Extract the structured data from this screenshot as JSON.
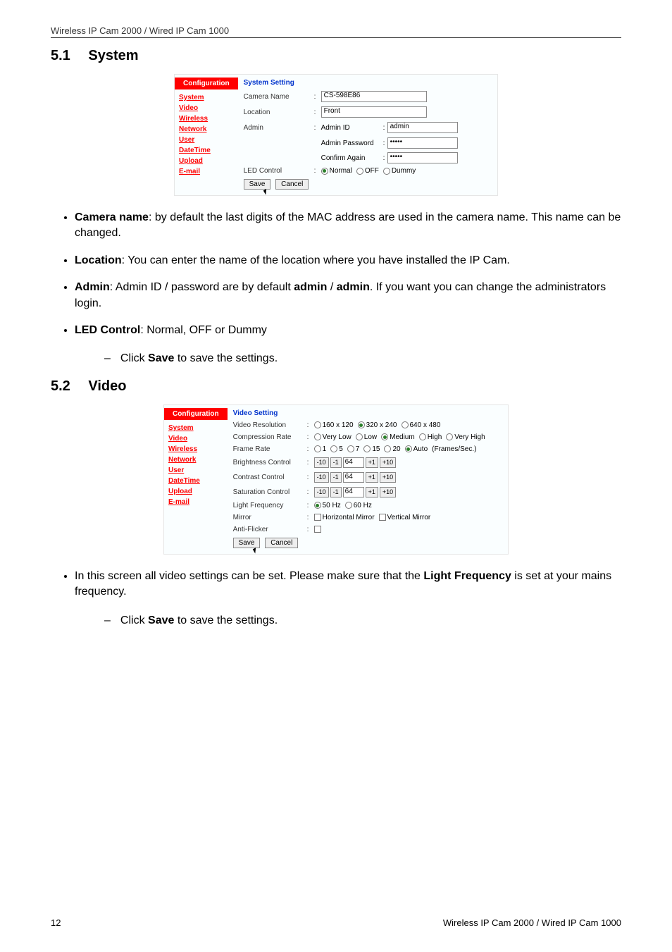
{
  "header": "Wireless IP Cam 2000 / Wired IP Cam 1000",
  "section51": {
    "num": "5.1",
    "title": "System"
  },
  "section52": {
    "num": "5.2",
    "title": "Video"
  },
  "sidebar": {
    "title": "Configuration",
    "items": [
      "System",
      "Video",
      "Wireless",
      "Network",
      "User",
      "DateTime",
      "Upload",
      "E-mail"
    ]
  },
  "systemPane": {
    "title": "System Setting",
    "cameraNameLabel": "Camera Name",
    "cameraNameValue": "CS-598E86",
    "locationLabel": "Location",
    "locationValue": "Front",
    "adminLabel": "Admin",
    "adminIdLabel": "Admin ID",
    "adminIdValue": "admin",
    "adminPwLabel": "Admin Password",
    "adminPwValue": "•••••",
    "confirmLabel": "Confirm Again",
    "confirmValue": "•••••",
    "ledLabel": "LED Control",
    "ledOpts": [
      "Normal",
      "OFF",
      "Dummy"
    ],
    "save": "Save",
    "cancel": "Cancel"
  },
  "videoPane": {
    "title": "Video Setting",
    "resLabel": "Video Resolution",
    "resOpts": [
      "160 x 120",
      "320 x 240",
      "640 x 480"
    ],
    "compLabel": "Compression Rate",
    "compOpts": [
      "Very Low",
      "Low",
      "Medium",
      "High",
      "Very High"
    ],
    "frameLabel": "Frame Rate",
    "frameOpts": [
      "1",
      "5",
      "7",
      "15",
      "20",
      "Auto"
    ],
    "frameSuffix": "(Frames/Sec.)",
    "brightnessLabel": "Brightness Control",
    "contrastLabel": "Contrast Control",
    "saturationLabel": "Saturation Control",
    "stepMinus10": "-10",
    "stepMinus1": "-1",
    "stepVal": "64",
    "stepPlus1": "+1",
    "stepPlus10": "+10",
    "lightFreqLabel": "Light Frequency",
    "lightFreqOpts": [
      "50 Hz",
      "60 Hz"
    ],
    "mirrorLabel": "Mirror",
    "mirrorOpts": [
      "Horizontal Mirror",
      "Vertical Mirror"
    ],
    "antiFlickerLabel": "Anti-Flicker",
    "save": "Save",
    "cancel": "Cancel"
  },
  "body": {
    "b1a": "Camera name",
    "b1b": ": by default the last digits of the MAC address are used in the camera name. This name can be changed.",
    "b2a": "Location",
    "b2b": ": You can enter the name of the location where you have installed the IP Cam.",
    "b3a": "Admin",
    "b3b": ": Admin ID / password are by default ",
    "b3c": "admin",
    "b3d": " / ",
    "b3e": "admin",
    "b3f": ". If you want you can change the administrators login.",
    "b4a": "LED Control",
    "b4b": ": Normal, OFF or Dummy",
    "b5a": "Click ",
    "b5b": "Save",
    "b5c": " to save the settings.",
    "b6a": "In this screen all video settings can be set. Please make sure that the ",
    "b6b": "Light Frequency",
    "b6c": " is set at your mains frequency."
  },
  "footer": {
    "page": "12",
    "title": "Wireless IP Cam 2000 / Wired IP Cam 1000"
  }
}
